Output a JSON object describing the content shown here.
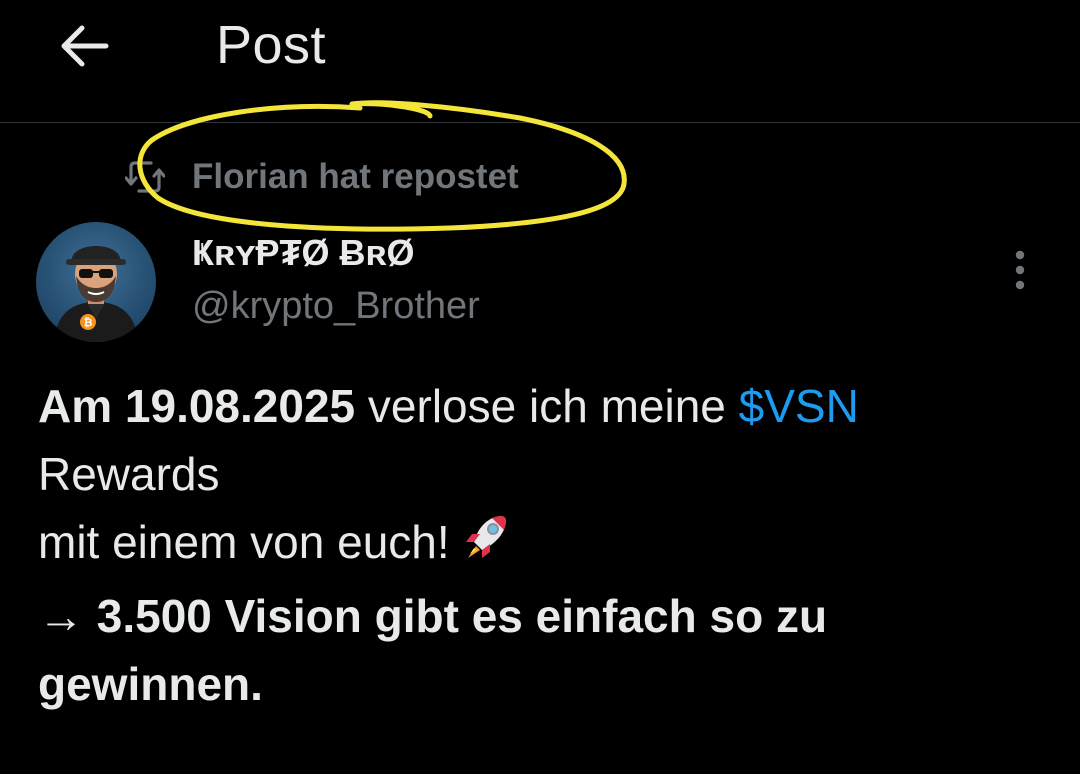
{
  "header": {
    "back_icon": "arrow-left-icon",
    "title": "Post"
  },
  "repost": {
    "icon": "repost-icon",
    "label": "Florian hat repostet",
    "highlight_color": "#f4e53a"
  },
  "author": {
    "avatar_icon": "avatar-bitcoin-guy",
    "name": "ҜʀʏⱣ₮Ø ɃʀØ",
    "handle": "@krypto_Brother"
  },
  "post": {
    "line1_date": "Am 19.08.2025",
    "line1_rest": " verlose ich meine ",
    "cashtag": "$VSN",
    "line2": "Rewards",
    "line3": "mit einem von euch!",
    "line3_emoji": "rocket-icon",
    "line4": " → 3.500 Vision gibt es einfach so zu",
    "line5": "gewinnen."
  },
  "colors": {
    "background": "#000000",
    "text": "#e7e9ea",
    "muted": "#71767b",
    "link": "#1d9bf0",
    "divider": "#2f3336"
  }
}
